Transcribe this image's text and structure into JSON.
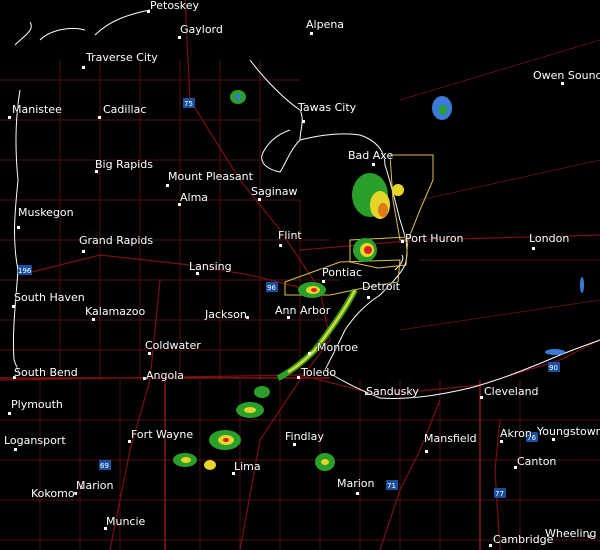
{
  "map": {
    "colors": {
      "background": "#000000",
      "water_outline": "#ffffff",
      "borders": "#8b1a1a",
      "highways": "#7a1010",
      "warning_polygon": "#e0c050"
    },
    "cities": [
      {
        "id": "petoskey",
        "name": "Petoskey"
      },
      {
        "id": "gaylord",
        "name": "Gaylord"
      },
      {
        "id": "alpena",
        "name": "Alpena"
      },
      {
        "id": "traverse-city",
        "name": "Traverse City"
      },
      {
        "id": "owen-sound",
        "name": "Owen Sound"
      },
      {
        "id": "manistee",
        "name": "Manistee"
      },
      {
        "id": "cadillac",
        "name": "Cadillac"
      },
      {
        "id": "tawas-city",
        "name": "Tawas City"
      },
      {
        "id": "big-rapids",
        "name": "Big Rapids"
      },
      {
        "id": "bad-axe",
        "name": "Bad Axe"
      },
      {
        "id": "mount-pleasant",
        "name": "Mount Pleasant"
      },
      {
        "id": "saginaw",
        "name": "Saginaw"
      },
      {
        "id": "alma",
        "name": "Alma"
      },
      {
        "id": "muskegon",
        "name": "Muskegon"
      },
      {
        "id": "flint",
        "name": "Flint"
      },
      {
        "id": "port-huron",
        "name": "Port Huron"
      },
      {
        "id": "london",
        "name": "London"
      },
      {
        "id": "grand-rapids",
        "name": "Grand Rapids"
      },
      {
        "id": "lansing",
        "name": "Lansing"
      },
      {
        "id": "pontiac",
        "name": "Pontiac"
      },
      {
        "id": "south-haven",
        "name": "South Haven"
      },
      {
        "id": "detroit",
        "name": "Detroit"
      },
      {
        "id": "kalamazoo",
        "name": "Kalamazoo"
      },
      {
        "id": "jackson",
        "name": "Jackson"
      },
      {
        "id": "ann-arbor",
        "name": "Ann Arbor"
      },
      {
        "id": "coldwater",
        "name": "Coldwater"
      },
      {
        "id": "monroe",
        "name": "Monroe"
      },
      {
        "id": "south-bend",
        "name": "South Bend"
      },
      {
        "id": "angola",
        "name": "Angola"
      },
      {
        "id": "toledo",
        "name": "Toledo"
      },
      {
        "id": "sandusky",
        "name": "Sandusky"
      },
      {
        "id": "cleveland",
        "name": "Cleveland"
      },
      {
        "id": "plymouth",
        "name": "Plymouth"
      },
      {
        "id": "fort-wayne",
        "name": "Fort Wayne"
      },
      {
        "id": "findlay",
        "name": "Findlay"
      },
      {
        "id": "akron",
        "name": "Akron"
      },
      {
        "id": "youngstown",
        "name": "Youngstown"
      },
      {
        "id": "logansport",
        "name": "Logansport"
      },
      {
        "id": "lima",
        "name": "Lima"
      },
      {
        "id": "mansfield",
        "name": "Mansfield"
      },
      {
        "id": "canton",
        "name": "Canton"
      },
      {
        "id": "kokomo",
        "name": "Kokomo"
      },
      {
        "id": "marion-in",
        "name": "Marion"
      },
      {
        "id": "marion-oh",
        "name": "Marion"
      },
      {
        "id": "muncie",
        "name": "Muncie"
      },
      {
        "id": "wheeling",
        "name": "Wheeling"
      },
      {
        "id": "cambridge",
        "name": "Cambridge"
      }
    ],
    "highway_shields": [
      {
        "id": "i75",
        "label": "75"
      },
      {
        "id": "i96",
        "label": "96"
      },
      {
        "id": "i96-west",
        "label": "196"
      },
      {
        "id": "i69",
        "label": "69"
      },
      {
        "id": "i90",
        "label": "90"
      },
      {
        "id": "i71",
        "label": "71"
      },
      {
        "id": "i77",
        "label": "77"
      },
      {
        "id": "i76",
        "label": "76"
      }
    ]
  }
}
